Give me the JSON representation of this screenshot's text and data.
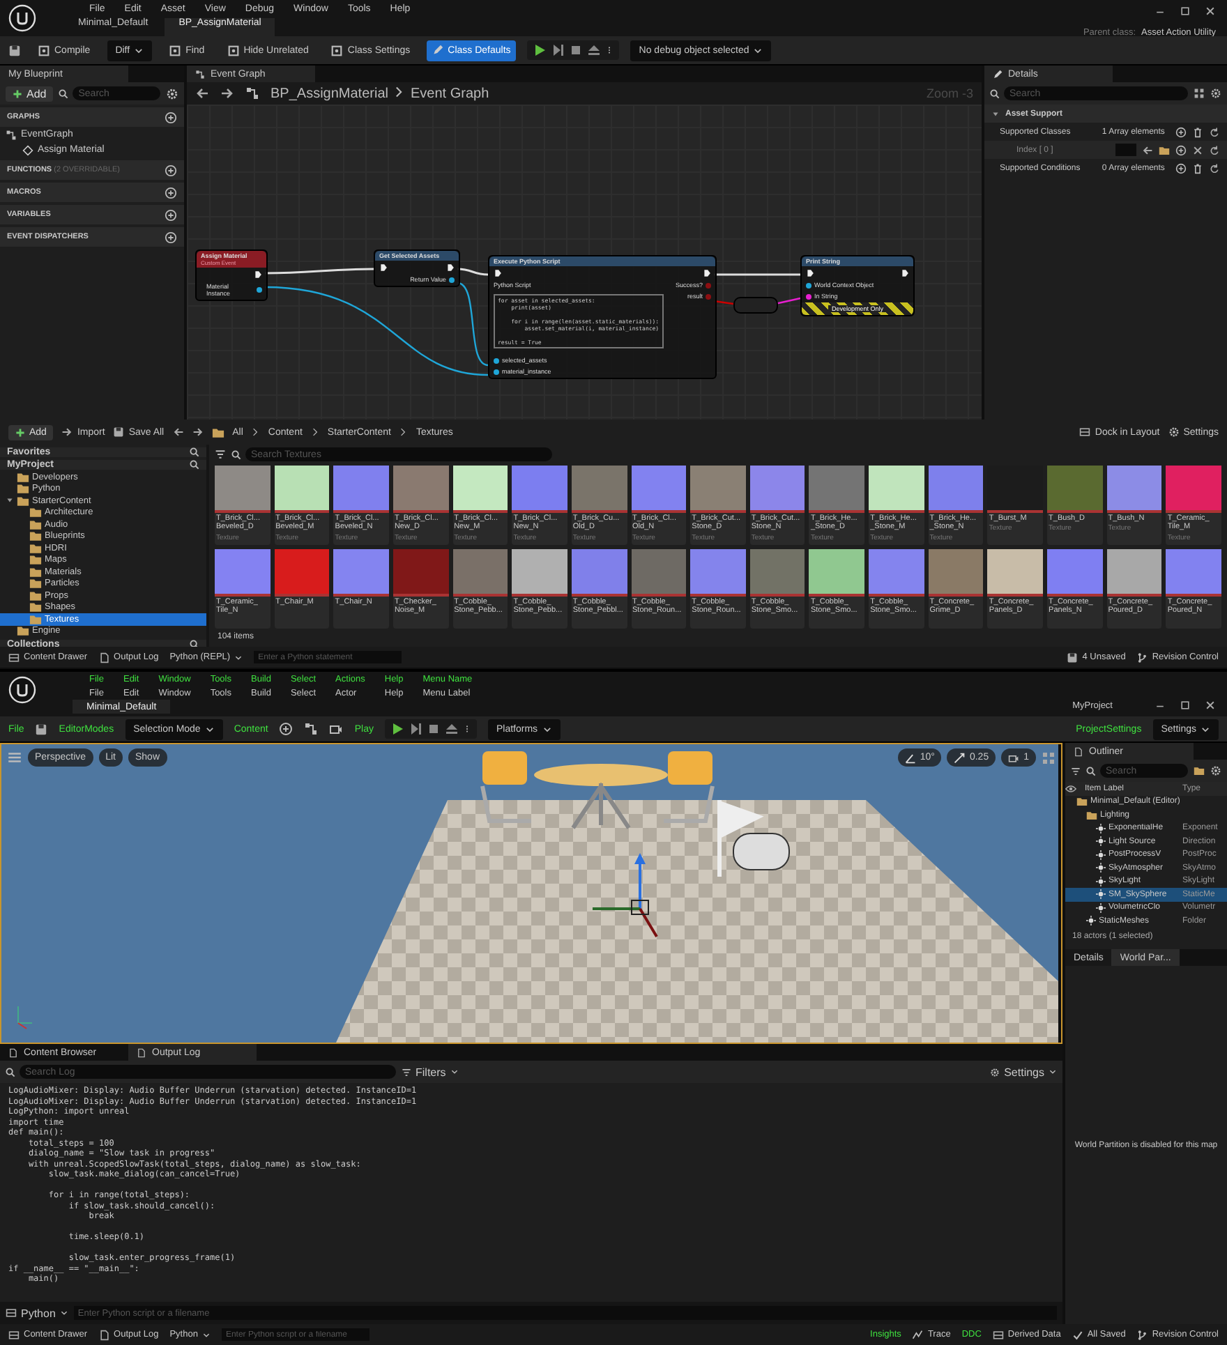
{
  "blueprint_editor": {
    "menu": [
      "File",
      "Edit",
      "Asset",
      "View",
      "Debug",
      "Window",
      "Tools",
      "Help"
    ],
    "doc_tabs": [
      {
        "label": "Minimal_Default",
        "selected": false
      },
      {
        "label": "BP_AssignMaterial",
        "selected": true
      }
    ],
    "parent_class_label": "Parent class:",
    "parent_class": "Asset Action Utility",
    "toolbar": [
      {
        "kind": "save"
      },
      {
        "kind": "button",
        "label": "Compile"
      },
      {
        "kind": "dropdown",
        "label": "Diff"
      },
      {
        "kind": "button",
        "label": "Find"
      },
      {
        "kind": "button",
        "label": "Hide Unrelated"
      },
      {
        "kind": "button",
        "label": "Class Settings"
      },
      {
        "kind": "primary",
        "label": "Class Defaults"
      },
      {
        "kind": "play"
      },
      {
        "kind": "dropdown",
        "label": "No debug object selected"
      }
    ],
    "my_blueprint": {
      "tab": "My Blueprint",
      "add": "Add",
      "search_placeholder": "Search",
      "sections": [
        {
          "title": "GRAPHS",
          "items": [
            {
              "label": "EventGraph",
              "children": [
                {
                  "label": "Assign Material"
                }
              ]
            }
          ]
        },
        {
          "title": "FUNCTIONS",
          "note": "(2 OVERRIDABLE)"
        },
        {
          "title": "MACROS"
        },
        {
          "title": "VARIABLES"
        },
        {
          "title": "EVENT DISPATCHERS"
        }
      ]
    },
    "graph": {
      "tab": "Event Graph",
      "breadcrumb": [
        "BP_AssignMaterial",
        "Event Graph"
      ],
      "zoom": "Zoom -3",
      "nodes": [
        {
          "kind": "event",
          "title": "Assign Material",
          "subtitle": "Custom Event",
          "outputs": [
            {
              "label": "Material Instance",
              "color": "#1fa6d8"
            }
          ]
        },
        {
          "kind": "function",
          "title": "Get Selected Assets",
          "outputs": [
            {
              "label": "Return Value",
              "color": "#1fa6d8"
            }
          ]
        },
        {
          "kind": "function",
          "title": "Execute Python Script",
          "script_label": "Python Script",
          "code": "for asset in selected_assets:\n    print(asset)\n\n    for i in range(len(asset.static_materials)):\n        asset.set_material(i, material_instance)\n\nresult = True",
          "inputs": [
            {
              "label": "selected_assets",
              "color": "#1fa6d8"
            },
            {
              "label": "material_instance",
              "color": "#1fa6d8"
            }
          ],
          "outputs": [
            {
              "label": "Success?",
              "color": "#8c0f12"
            },
            {
              "label": "result",
              "color": "#8c0f12"
            }
          ]
        },
        {
          "kind": "convert"
        },
        {
          "kind": "function",
          "title": "Print String",
          "inputs": [
            {
              "label": "World Context Object",
              "color": "#1fa6d8"
            },
            {
              "label": "In String",
              "color": "#e81fd0"
            }
          ],
          "footer": "Development Only"
        }
      ]
    },
    "details": {
      "tab": "Details",
      "search_placeholder": "Search",
      "category": "Asset Support",
      "rows": [
        {
          "kind": "array",
          "label": "Supported Classes",
          "value": "1 Array elements"
        },
        {
          "kind": "element",
          "label": "Index [ 0 ]"
        },
        {
          "kind": "array",
          "label": "Supported Conditions",
          "value": "0 Array elements"
        }
      ]
    },
    "content_browser": {
      "add": "Add",
      "import": "Import",
      "save_all": "Save All",
      "path": [
        "All",
        "Content",
        "StarterContent",
        "Textures"
      ],
      "dock": "Dock in Layout",
      "settings": "Settings",
      "favorites": "Favorites",
      "project": "MyProject",
      "tree": [
        {
          "label": "Developers",
          "selected": false
        },
        {
          "label": "Python",
          "selected": false
        },
        {
          "label": "StarterContent",
          "selected": false,
          "children": [
            {
              "label": "Architecture",
              "selected": false
            },
            {
              "label": "Audio",
              "selected": false
            },
            {
              "label": "Blueprints",
              "selected": false
            },
            {
              "label": "HDRI",
              "selected": false
            },
            {
              "label": "Maps",
              "selected": false
            },
            {
              "label": "Materials",
              "selected": false
            },
            {
              "label": "Particles",
              "selected": false
            },
            {
              "label": "Props",
              "selected": false
            },
            {
              "label": "Shapes",
              "selected": false
            },
            {
              "label": "Textures",
              "selected": true
            }
          ]
        },
        {
          "label": "Engine",
          "selected": false
        }
      ],
      "collections": "Collections",
      "search_placeholder": "Search Textures",
      "count": "104 items",
      "tiles": [
        {
          "name": "T_Brick_Cl...\nBeveled_D",
          "type": "Texture",
          "color": "#8e8a86"
        },
        {
          "name": "T_Brick_Cl...\nBeveled_M",
          "type": "Texture",
          "color": "#b8e0b4"
        },
        {
          "name": "T_Brick_Cl...\nBeveled_N",
          "type": "Texture",
          "color": "#8080ee"
        },
        {
          "name": "T_Brick_Cl...\nNew_D",
          "type": "Texture",
          "color": "#8a7a70"
        },
        {
          "name": "T_Brick_Cl...\nNew_M",
          "type": "Texture",
          "color": "#c4e8c0"
        },
        {
          "name": "T_Brick_Cl...\nNew_N",
          "type": "Texture",
          "color": "#7c7ef0"
        },
        {
          "name": "T_Brick_Cu...\nOld_D",
          "type": "Texture",
          "color": "#7a746a"
        },
        {
          "name": "T_Brick_Cl...\nOld_N",
          "type": "Texture",
          "color": "#8282f0"
        },
        {
          "name": "T_Brick_Cut...\nStone_D",
          "type": "Texture",
          "color": "#8a8074"
        },
        {
          "name": "T_Brick_Cut...\nStone_N",
          "type": "Texture",
          "color": "#8c86ea"
        },
        {
          "name": "T_Brick_He...\n_Stone_D",
          "type": "Texture",
          "color": "#747474"
        },
        {
          "name": "T_Brick_He...\n_Stone_M",
          "type": "Texture",
          "color": "#c0e4bc"
        },
        {
          "name": "T_Brick_He...\n_Stone_N",
          "type": "Texture",
          "color": "#7e80ec"
        },
        {
          "name": "T_Burst_M",
          "type": "Texture",
          "color": "#1c1c1c"
        },
        {
          "name": "T_Bush_D",
          "type": "Texture",
          "color": "#5a6a30"
        },
        {
          "name": "T_Bush_N",
          "type": "Texture",
          "color": "#8c8ce6"
        },
        {
          "name": "T_Ceramic_\nTile_M",
          "type": "Texture",
          "color": "#e02060"
        },
        {
          "name": "T_Ceramic_\nTile_N",
          "color": "#8482f2"
        },
        {
          "name": "T_Chair_M",
          "color": "#d81c1c"
        },
        {
          "name": "T_Chair_N",
          "color": "#8484f0"
        },
        {
          "name": "T_Checker_\nNoise_M",
          "color": "#801818"
        },
        {
          "name": "T_Cobble_\nStone_Pebb...",
          "color": "#7a7068"
        },
        {
          "name": "T_Cobble_\nStone_Pebb...",
          "color": "#b0b0b0"
        },
        {
          "name": "T_Cobble_\nStone_Pebbl...",
          "color": "#8080ea"
        },
        {
          "name": "T_Cobble_\nStone_Roun...",
          "color": "#6e6a64"
        },
        {
          "name": "T_Cobble_\nStone_Roun...",
          "color": "#8484ec"
        },
        {
          "name": "T_Cobble_\nStone_Smo...",
          "color": "#727266"
        },
        {
          "name": "T_Cobble_\nStone_Smo...",
          "color": "#90c890"
        },
        {
          "name": "T_Cobble_\nStone_Smo...",
          "color": "#8484ee"
        },
        {
          "name": "T_Concrete_\nGrime_D",
          "color": "#8a7a66"
        },
        {
          "name": "T_Concrete_\nPanels_D",
          "color": "#c8bca8"
        },
        {
          "name": "T_Concrete_\nPanels_N",
          "color": "#7f7ff2"
        },
        {
          "name": "T_Concrete_\nPoured_D",
          "color": "#a8a8a8"
        },
        {
          "name": "T_Concrete_\nPoured_N",
          "color": "#8282f0"
        }
      ],
      "status": {
        "drawer": "Content Drawer",
        "log": "Output Log",
        "python": "Python (REPL)",
        "placeholder": "Enter a Python statement",
        "unsaved": "4 Unsaved",
        "revision": "Revision Control"
      }
    }
  },
  "level_editor": {
    "menus": [
      {
        "name": "File",
        "label": "File"
      },
      {
        "name": "Edit",
        "label": "Edit"
      },
      {
        "name": "Window",
        "label": "Window"
      },
      {
        "name": "Tools",
        "label": "Tools"
      },
      {
        "name": "Build",
        "label": "Build"
      },
      {
        "name": "Select",
        "label": "Select"
      },
      {
        "name": "Actions",
        "label": "Actor"
      },
      {
        "name": "Help",
        "label": "Help"
      },
      {
        "name": "Menu Name",
        "label": "Menu Label"
      }
    ],
    "doc_tab": "Minimal_Default",
    "project": "MyProject",
    "toolbar": [
      {
        "kind": "section",
        "label": "File"
      },
      {
        "kind": "save"
      },
      {
        "kind": "section",
        "label": "EditorModes"
      },
      {
        "kind": "dropdown",
        "label": "Selection Mode"
      },
      {
        "kind": "section",
        "label": "Content"
      },
      {
        "kind": "content_icons"
      },
      {
        "kind": "section",
        "label": "Play"
      },
      {
        "kind": "play"
      },
      {
        "kind": "dropdown",
        "label": "Platforms"
      },
      {
        "kind": "spacer"
      },
      {
        "kind": "section",
        "label": "ProjectSettings"
      },
      {
        "kind": "dropdown",
        "label": "Settings"
      }
    ],
    "viewport": {
      "view_buttons": [
        "Perspective",
        "Lit",
        "Show"
      ],
      "angle_snap": "10°",
      "scale_snap": "0.25",
      "camera_speed": "1"
    },
    "outliner": {
      "tab": "Outliner",
      "search_placeholder": "Search",
      "columns": [
        "Item Label",
        "Type"
      ],
      "rows": [
        {
          "label": "Minimal_Default (Editor)",
          "selected": false,
          "children": [
            {
              "label": "Lighting",
              "selected": false,
              "children": [
                {
                  "label": "ExponentialHe",
                  "type": "Exponent",
                  "selected": false
                },
                {
                  "label": "Light Source",
                  "type": "Direction",
                  "selected": false
                },
                {
                  "label": "PostProcessV",
                  "type": "PostProc",
                  "selected": false
                },
                {
                  "label": "SkyAtmospher",
                  "type": "SkyAtmo",
                  "selected": false
                },
                {
                  "label": "SkyLight",
                  "type": "SkyLight",
                  "selected": false
                },
                {
                  "label": "SM_SkySphere",
                  "type": "StaticMe",
                  "selected": true
                },
                {
                  "label": "VolumetricClo",
                  "type": "Volumetr",
                  "selected": false
                }
              ]
            },
            {
              "label": "StaticMeshes",
              "type": "Folder",
              "selected": false
            }
          ]
        }
      ],
      "count": "18 actors (1 selected)"
    },
    "details_tabs": [
      {
        "label": "Details",
        "selected": false
      },
      {
        "label": "World Par...",
        "selected": true
      }
    ],
    "details_message": "World Partition is disabled for this map",
    "log": {
      "tabs": [
        {
          "label": "Content Browser",
          "selected": false
        },
        {
          "label": "Output Log",
          "selected": true
        }
      ],
      "search_placeholder": "Search Log",
      "filters": "Filters",
      "settings": "Settings",
      "text": "LogAudioMixer: Display: Audio Buffer Underrun (starvation) detected. InstanceID=1\nLogAudioMixer: Display: Audio Buffer Underrun (starvation) detected. InstanceID=1\nLogPython: import unreal\nimport time\ndef main():\n    total_steps = 100\n    dialog_name = \"Slow task in progress\"\n    with unreal.ScopedSlowTask(total_steps, dialog_name) as slow_task:\n        slow_task.make_dialog(can_cancel=True)\n\n        for i in range(total_steps):\n            if slow_task.should_cancel():\n                break\n\n            time.sleep(0.1)\n\n            slow_task.enter_progress_frame(1)\nif __name__ == \"__main__\":\n    main()",
      "python": "Python",
      "placeholder": "Enter Python script or a filename"
    },
    "status": {
      "drawer": "Content Drawer",
      "log": "Output Log",
      "python": "Python",
      "placeholder": "Enter Python script or a filename",
      "insights": "Insights",
      "trace": "Trace",
      "ddc": "DDC",
      "derived": "Derived Data",
      "saved": "All Saved",
      "revision": "Revision Control"
    }
  }
}
